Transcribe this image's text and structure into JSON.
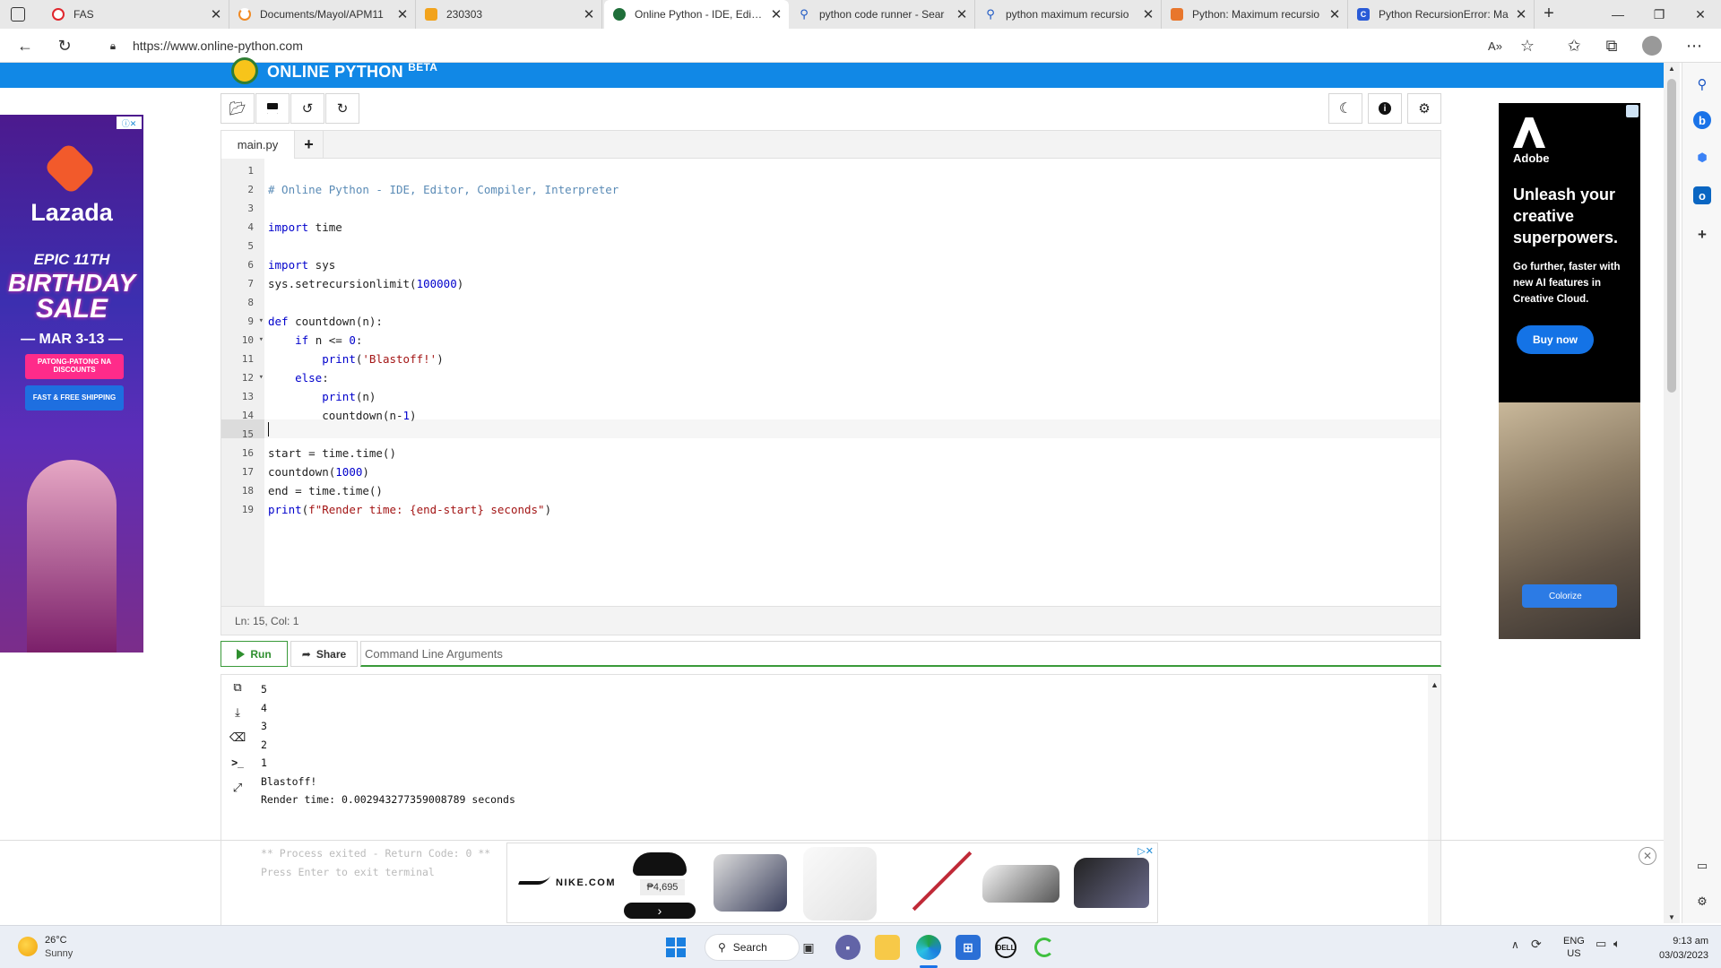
{
  "browser": {
    "tabs": [
      {
        "title": "FAS",
        "icon": "opera-icon",
        "active": false
      },
      {
        "title": "Documents/Mayol/APM11",
        "icon": "loading-icon",
        "active": false
      },
      {
        "title": "230303",
        "icon": "slides-icon",
        "active": false
      },
      {
        "title": "Online Python - IDE, Editor",
        "icon": "online-python-icon",
        "active": true
      },
      {
        "title": "python code runner - Sear",
        "icon": "search-icon",
        "active": false
      },
      {
        "title": "python maximum recursio",
        "icon": "search-icon",
        "active": false
      },
      {
        "title": "Python: Maximum recursio",
        "icon": "python-icon",
        "active": false
      },
      {
        "title": "Python RecursionError: Ma",
        "icon": "c-icon",
        "active": false
      }
    ],
    "url": "https://www.online-python.com"
  },
  "site": {
    "brand": "ONLINE PYTHON",
    "brand_badge": "BETA"
  },
  "editor": {
    "file_tab": "main.py",
    "add_tab": "+",
    "status": "Ln: 15,  Col: 1",
    "lines": [
      {
        "n": "1",
        "text": ""
      },
      {
        "n": "2",
        "text": "# Online Python - IDE, Editor, Compiler, Interpreter"
      },
      {
        "n": "3",
        "text": ""
      },
      {
        "n": "4",
        "text": "import time"
      },
      {
        "n": "5",
        "text": ""
      },
      {
        "n": "6",
        "text": "import sys"
      },
      {
        "n": "7",
        "text": "sys.setrecursionlimit(100000)"
      },
      {
        "n": "8",
        "text": ""
      },
      {
        "n": "9",
        "text": "def countdown(n):"
      },
      {
        "n": "10",
        "text": "    if n <= 0:"
      },
      {
        "n": "11",
        "text": "        print('Blastoff!')"
      },
      {
        "n": "12",
        "text": "    else:"
      },
      {
        "n": "13",
        "text": "        print(n)"
      },
      {
        "n": "14",
        "text": "        countdown(n-1)"
      },
      {
        "n": "15",
        "text": ""
      },
      {
        "n": "16",
        "text": "start = time.time()"
      },
      {
        "n": "17",
        "text": "countdown(1000)"
      },
      {
        "n": "18",
        "text": "end = time.time()"
      },
      {
        "n": "19",
        "text": "print(f\"Render time: {end-start} seconds\")"
      }
    ]
  },
  "runbar": {
    "run_label": "Run",
    "share_label": "Share",
    "args_placeholder": "Command Line Arguments"
  },
  "terminal": {
    "lines": [
      "5",
      "4",
      "3",
      "2",
      "1",
      "Blastoff!",
      "Render time: 0.0029432773590087​89 seconds"
    ],
    "exit_line": "** Process exited - Return Code: 0 **",
    "enter_line": "Press Enter to exit terminal"
  },
  "ads": {
    "lazada": {
      "brand": "Lazada",
      "headline1": "EPIC 11TH",
      "headline2": "BIRTHDAY",
      "headline3": "SALE",
      "dates": "— MAR 3-13 —",
      "chip1": "PATONG-PATONG NA DISCOUNTS",
      "chip2": "FAST & FREE SHIPPING"
    },
    "adobe": {
      "brand": "Adobe",
      "headline": "Unleash your creative superpowers.",
      "sub": "Go further, faster with new AI features in Creative Cloud.",
      "cta": "Buy now",
      "colorize": "Colorize"
    },
    "nike": {
      "brand": "NIKE.COM",
      "price": "₱4,695"
    }
  },
  "taskbar": {
    "weather_temp": "26°C",
    "weather_desc": "Sunny",
    "search_label": "Search",
    "lang_top": "ENG",
    "lang_bottom": "US",
    "time": "9:13 am",
    "date": "03/03/2023"
  },
  "colors": {
    "site_header": "#1188e6",
    "run_green": "#2f8f2f",
    "keyword": "#0000cc",
    "comment": "#5a8bb6"
  }
}
